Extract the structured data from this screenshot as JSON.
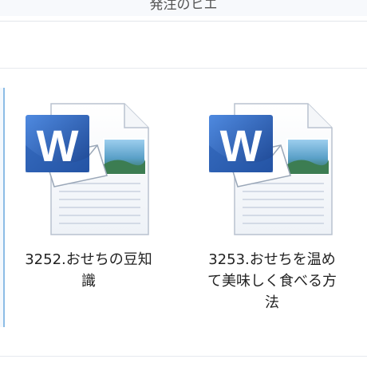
{
  "window": {
    "title": "発注のヒエ"
  },
  "files": [
    {
      "name": "3252.おせちの豆知識",
      "icon": "word-document-icon"
    },
    {
      "name": "3253.おせちを温めて美味しく食べる方法",
      "icon": "word-document-icon"
    }
  ],
  "colors": {
    "word_blue": "#2b64b8",
    "word_blue_dark": "#1c4591",
    "page_lines": "#c9d2e0",
    "selection_edge": "#8cbce6"
  }
}
